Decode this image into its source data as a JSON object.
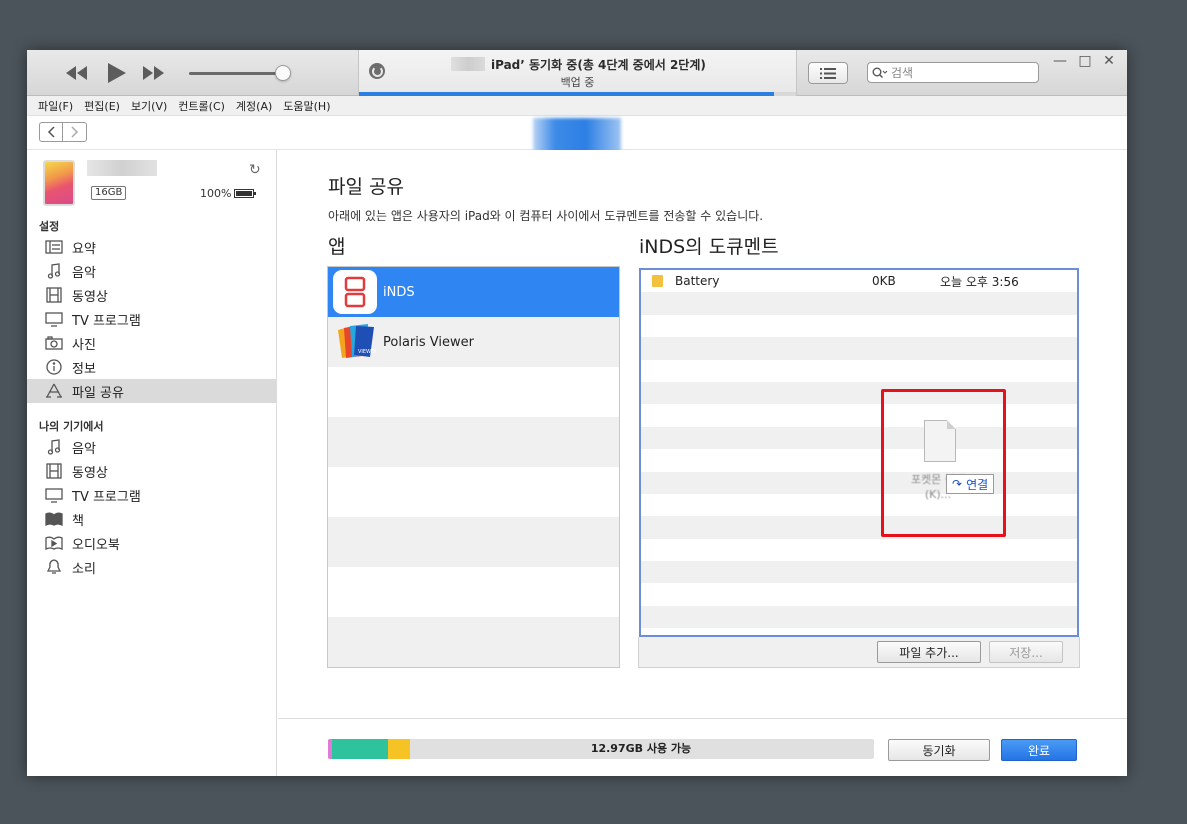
{
  "titlebar": {
    "title": "iPad’ 동기화 중(총 4단계 중에서 2단계)",
    "subtitle": "백업 중",
    "progress": 0.95,
    "search_placeholder": "검색",
    "controls": {
      "minimize": "—",
      "maximize": "□",
      "close": "✕"
    }
  },
  "menu": [
    "파일(F)",
    "편집(E)",
    "보기(V)",
    "컨트롤(C)",
    "계정(A)",
    "도움말(H)"
  ],
  "device": {
    "capacity": "16GB",
    "battery": "100%",
    "battery_level": 1.0
  },
  "sidebar": {
    "settings_title": "설정",
    "settings_items": [
      {
        "label": "요약",
        "icon": "summary-icon"
      },
      {
        "label": "음악",
        "icon": "music-icon"
      },
      {
        "label": "동영상",
        "icon": "film-icon"
      },
      {
        "label": "TV 프로그램",
        "icon": "tv-icon"
      },
      {
        "label": "사진",
        "icon": "camera-icon"
      },
      {
        "label": "정보",
        "icon": "info-icon"
      },
      {
        "label": "파일 공유",
        "icon": "file-sharing-icon"
      }
    ],
    "ondevice_title": "나의 기기에서",
    "ondevice_items": [
      {
        "label": "음악",
        "icon": "music-icon"
      },
      {
        "label": "동영상",
        "icon": "film-icon"
      },
      {
        "label": "TV 프로그램",
        "icon": "tv-icon"
      },
      {
        "label": "책",
        "icon": "book-icon"
      },
      {
        "label": "오디오북",
        "icon": "audiobook-icon"
      },
      {
        "label": "소리",
        "icon": "bell-icon"
      }
    ]
  },
  "main": {
    "title": "파일 공유",
    "description": "아래에 있는 앱은 사용자의 iPad와 이 컴퓨터 사이에서 도큐멘트를 전송할 수 있습니다.",
    "apps_header": "앱",
    "docs_header": "iNDS의 도큐멘트",
    "apps": [
      {
        "name": "iNDS"
      },
      {
        "name": "Polaris Viewer"
      }
    ],
    "documents": [
      {
        "name": "Battery",
        "size": "0KB",
        "date": "오늘 오후 3:56"
      }
    ],
    "drag": {
      "file_label": "포켓몬 블랙(K)...",
      "tooltip": "연결"
    },
    "add_file_button": "파일 추가...",
    "save_button": "저장..."
  },
  "footer": {
    "storage_label": "12.97GB 사용 가능",
    "sync_button": "동기화",
    "done_button": "완료",
    "colors": {
      "pink": "#e07ad8",
      "teal": "#2ec29d",
      "yellow": "#f6c324",
      "free": "#e0e0e0"
    }
  }
}
